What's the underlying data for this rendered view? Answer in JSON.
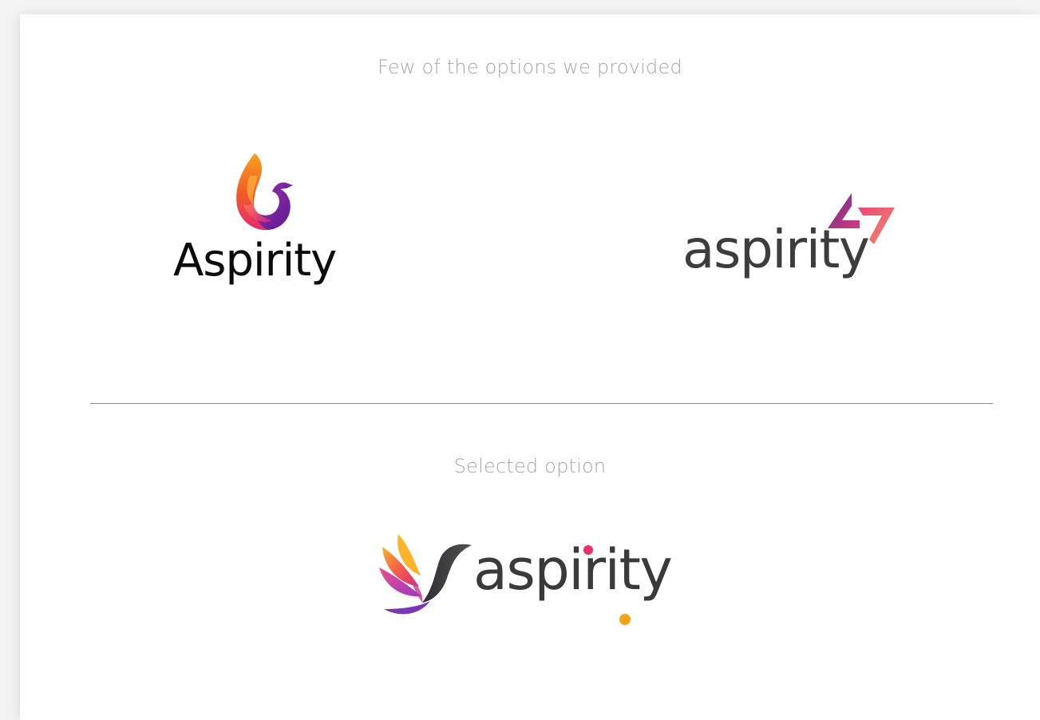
{
  "section_options": {
    "heading": "Few of the options we provided"
  },
  "section_selected": {
    "heading": "Selected option"
  },
  "logos": [
    {
      "wordmark": "Aspirity",
      "icon": "phoenix-flame-icon"
    },
    {
      "wordmark": "aspirity",
      "icon": "triangle-arrows-icon"
    },
    {
      "wordmark": "aspirity",
      "icon": "bird-wing-icon"
    }
  ],
  "colors": {
    "heading": "#a6a6a6",
    "divider": "#8a8a8a",
    "accent_pink": "#ea2f6b",
    "accent_orange": "#f7a11a",
    "accent_purple": "#7b2cbf"
  }
}
